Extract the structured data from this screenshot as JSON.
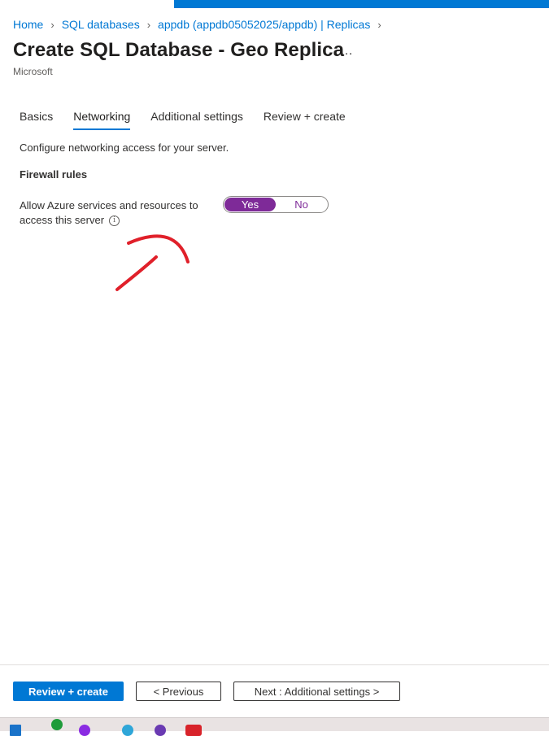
{
  "breadcrumb": [
    "Home",
    "SQL databases",
    "appdb (appdb05052025/appdb) | Replicas"
  ],
  "header": {
    "title": "Create SQL Database - Geo Replica",
    "more_icon": "…",
    "subtitle": "Microsoft"
  },
  "tabs": [
    {
      "label": "Basics",
      "active": false
    },
    {
      "label": "Networking",
      "active": true
    },
    {
      "label": "Additional settings",
      "active": false
    },
    {
      "label": "Review + create",
      "active": false
    }
  ],
  "networking": {
    "description": "Configure networking access for your server.",
    "section_heading": "Firewall rules",
    "allow_azure_label": "Allow Azure services and resources to access this server",
    "info_icon": "i",
    "toggle": {
      "yes": "Yes",
      "no": "No",
      "selected": "Yes"
    }
  },
  "footer": {
    "review_create": "Review + create",
    "previous": "< Previous",
    "next": "Next : Additional settings >"
  },
  "colors": {
    "accent": "#0078d4",
    "toggle_selected": "#7e2a98",
    "annotation": "#e0202a"
  }
}
